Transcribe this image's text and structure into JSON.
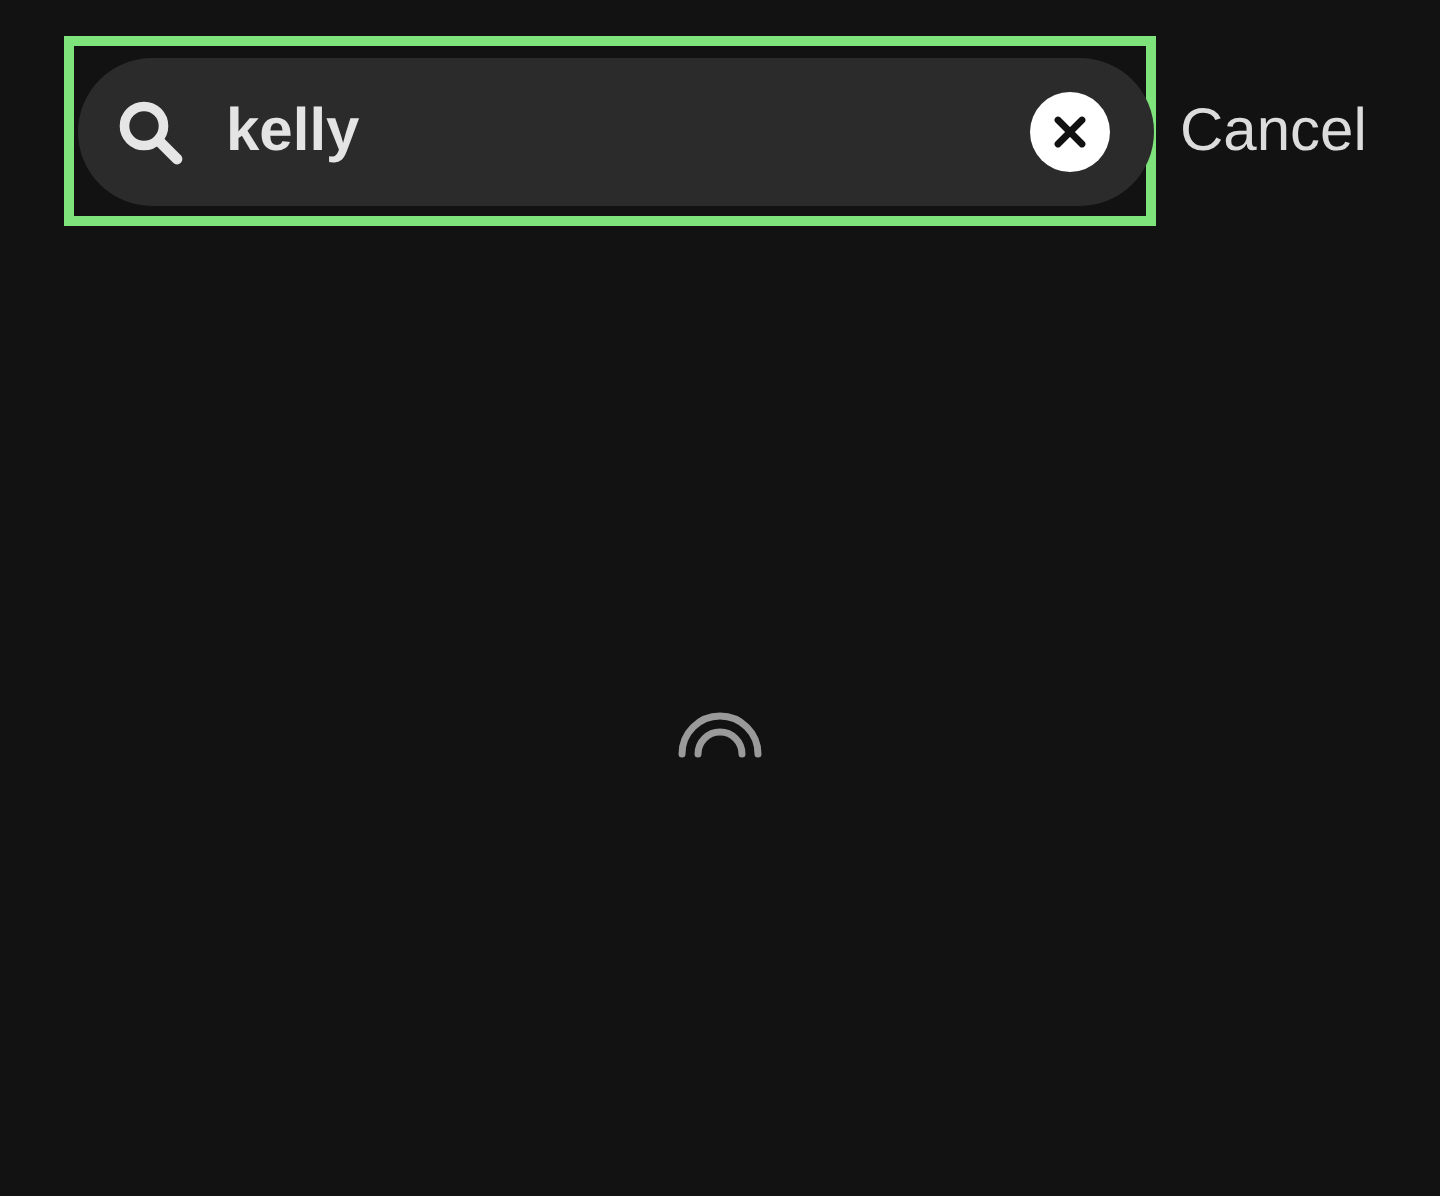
{
  "search": {
    "value": "kelly",
    "highlighted": true
  },
  "cancel": "Cancel",
  "loading": true
}
